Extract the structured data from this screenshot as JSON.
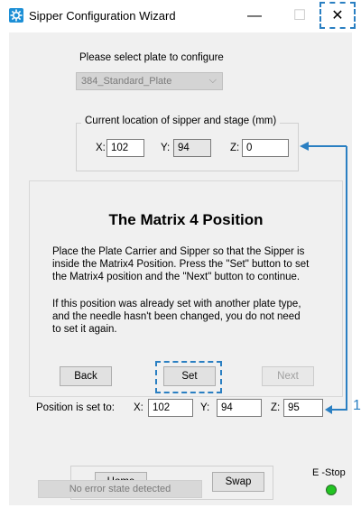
{
  "window": {
    "title": "Sipper Configuration Wizard",
    "minimize_glyph": "—",
    "maximize_glyph": "☐",
    "close_glyph": "✕"
  },
  "plate": {
    "prompt": "Please select plate to configure",
    "selected": "384_Standard_Plate"
  },
  "current_location": {
    "group_title": "Current location of sipper and stage (mm)",
    "x_label": "X:",
    "x_value": "102",
    "y_label": "Y:",
    "y_value": "94",
    "z_label": "Z:",
    "z_value": "0"
  },
  "panel": {
    "heading": "The Matrix 4 Position",
    "paragraph1": [
      "Place the Plate Carrier and Sipper so that the Sipper is",
      "inside the Matrix4 Position. Press the \"Set\" button to set",
      "the Matrix4 position and the \"Next\" button to continue."
    ],
    "paragraph2": [
      "If this position was already set with another plate type,",
      "and the needle hasn't been changed, you do not need",
      "to set it again."
    ],
    "back_label": "Back",
    "set_label": "Set",
    "next_label": "Next"
  },
  "position_set": {
    "label": "Position is set to:",
    "x_label": "X:",
    "x_value": "102",
    "y_label": "Y:",
    "y_value": "94",
    "z_label": "Z:",
    "z_value": "95"
  },
  "controls": {
    "home_label": "Home",
    "swap_label": "Swap",
    "estop_label": "E -Stop"
  },
  "status": {
    "message": "No error state detected"
  },
  "annotation": {
    "callout_number": "1"
  },
  "colors": {
    "accent": "#2a7fc2",
    "estop_led": "#22c422"
  },
  "icons": {
    "app": "gear-app-icon",
    "combo": "chevron-down-icon"
  }
}
